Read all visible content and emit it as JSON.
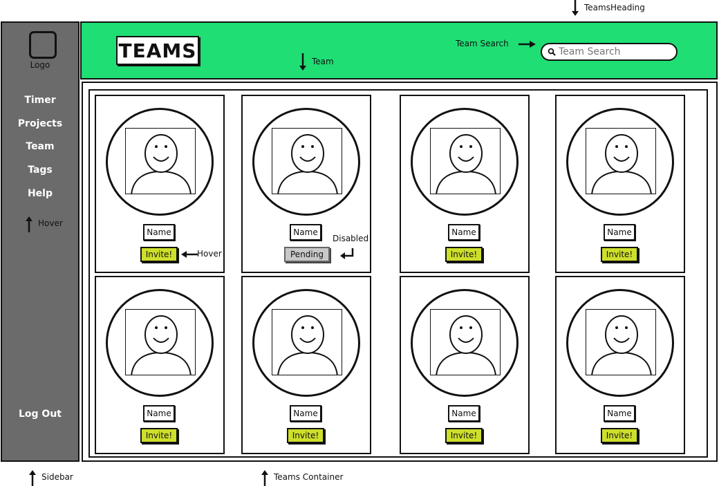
{
  "annotations": {
    "teams_heading": "TeamsHeading",
    "team": "Team",
    "team_search": "Team Search",
    "hover_sidebar": "Hover",
    "hover_card": "Hover",
    "disabled": "Disabled",
    "sidebar": "Sidebar",
    "teams_container": "Teams Container"
  },
  "sidebar": {
    "logo_label": "Logo",
    "items": [
      {
        "label": "Timer"
      },
      {
        "label": "Projects"
      },
      {
        "label": "Team"
      },
      {
        "label": "Tags"
      },
      {
        "label": "Help"
      }
    ],
    "logout_label": "Log Out"
  },
  "header": {
    "title": "TEAMS",
    "search_placeholder": "Team Search"
  },
  "cards": [
    {
      "name": "Name",
      "button": "Invite!",
      "state": "hover"
    },
    {
      "name": "Name",
      "button": "Pending",
      "state": "disabled"
    },
    {
      "name": "Name",
      "button": "Invite!",
      "state": "normal"
    },
    {
      "name": "Name",
      "button": "Invite!",
      "state": "normal"
    },
    {
      "name": "Name",
      "button": "Invite!",
      "state": "normal"
    },
    {
      "name": "Name",
      "button": "Invite!",
      "state": "normal"
    },
    {
      "name": "Name",
      "button": "Invite!",
      "state": "normal"
    },
    {
      "name": "Name",
      "button": "Invite!",
      "state": "normal"
    }
  ],
  "colors": {
    "header_bg": "#1fde73",
    "sidebar_bg": "#6b6b6b",
    "invite_bg": "#cddf2b",
    "pending_bg": "#c8c8c8"
  }
}
